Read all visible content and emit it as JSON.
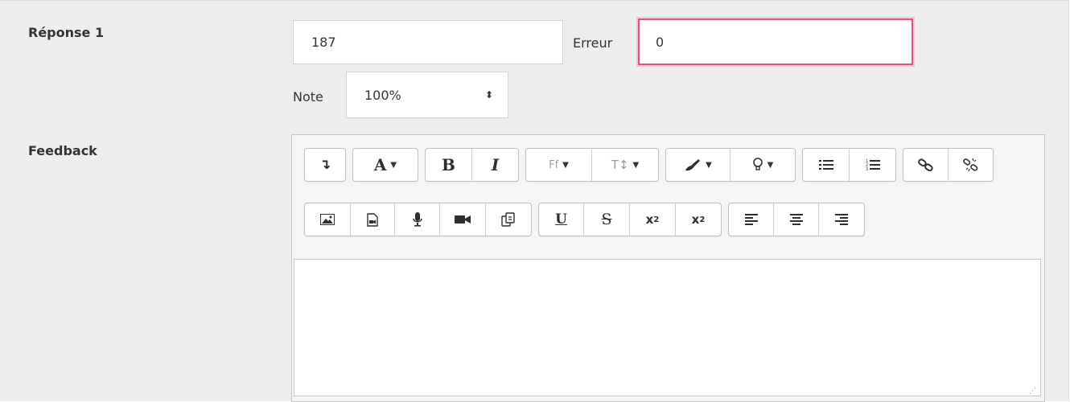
{
  "answer": {
    "label": "Réponse 1",
    "value": "187",
    "error_label": "Erreur",
    "error_value": "0",
    "grade_label": "Note",
    "grade_value": "100%"
  },
  "feedback": {
    "label": "Feedback",
    "toolbar_row1": [
      {
        "group": "collapse",
        "buttons": [
          {
            "icon": "collapse-toggle-icon",
            "glyph": "↴"
          }
        ]
      },
      {
        "group": "style",
        "buttons": [
          {
            "icon": "paragraph-style-icon",
            "glyph": "A",
            "caret": "▾"
          }
        ]
      },
      {
        "group": "bold-italic",
        "buttons": [
          {
            "icon": "bold-icon",
            "glyph": "B"
          },
          {
            "icon": "italic-icon",
            "glyph": "I"
          }
        ]
      },
      {
        "group": "font",
        "buttons": [
          {
            "icon": "font-family-icon",
            "glyph": "Ff",
            "caret": "▾"
          },
          {
            "icon": "font-size-icon",
            "glyph": "T↕",
            "caret": "▾"
          }
        ]
      },
      {
        "group": "color",
        "buttons": [
          {
            "icon": "font-color-icon",
            "glyph": "🖌",
            "caret": "▾"
          },
          {
            "icon": "background-color-icon",
            "glyph": "💡",
            "caret": "▾"
          }
        ]
      },
      {
        "group": "lists",
        "buttons": [
          {
            "icon": "unordered-list-icon",
            "glyph": "☰"
          },
          {
            "icon": "ordered-list-icon",
            "glyph": "☷"
          }
        ]
      },
      {
        "group": "links",
        "buttons": [
          {
            "icon": "link-icon",
            "glyph": "🔗"
          },
          {
            "icon": "unlink-icon",
            "glyph": "⛓"
          }
        ]
      }
    ],
    "toolbar_row2": [
      {
        "group": "media",
        "buttons": [
          {
            "icon": "image-icon"
          },
          {
            "icon": "media-file-icon"
          },
          {
            "icon": "record-audio-icon"
          },
          {
            "icon": "record-video-icon"
          },
          {
            "icon": "manage-files-icon"
          }
        ]
      },
      {
        "group": "format",
        "buttons": [
          {
            "icon": "underline-icon",
            "glyph": "U"
          },
          {
            "icon": "strikethrough-icon",
            "glyph": "S"
          },
          {
            "icon": "subscript-icon",
            "glyph": "x₂"
          },
          {
            "icon": "superscript-icon",
            "glyph": "x²"
          }
        ]
      },
      {
        "group": "align",
        "buttons": [
          {
            "icon": "align-left-icon"
          },
          {
            "icon": "align-center-icon"
          },
          {
            "icon": "align-right-icon"
          }
        ]
      }
    ],
    "content": ""
  },
  "colors": {
    "panel_bg": "#eeeeee",
    "error_border": "#e0508a"
  }
}
